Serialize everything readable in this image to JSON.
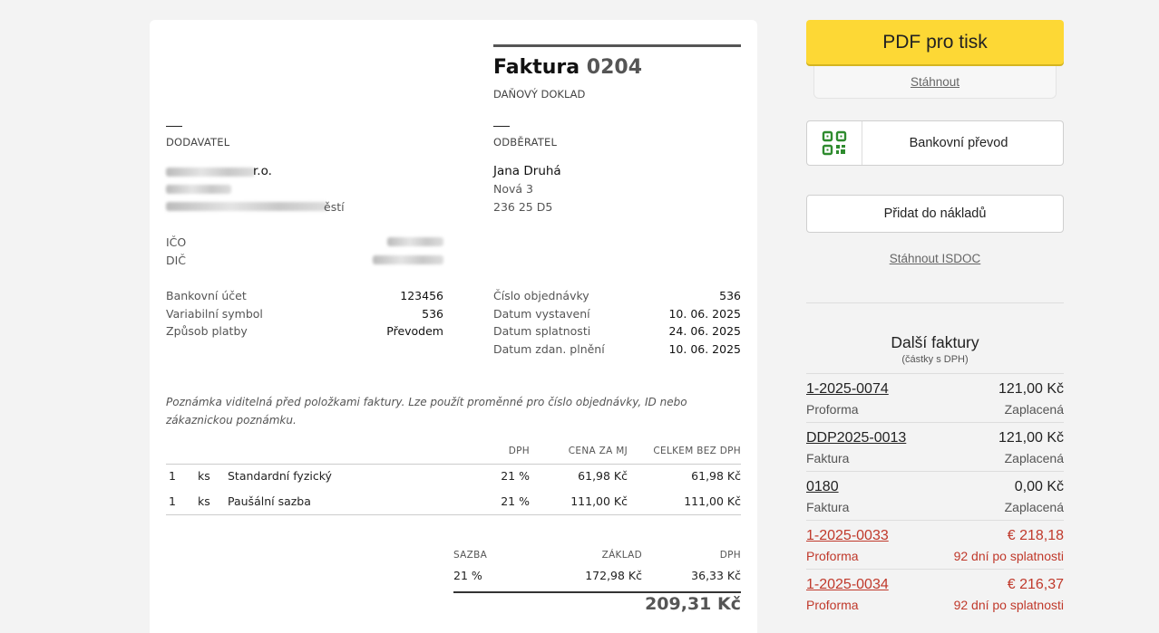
{
  "invoice": {
    "title_prefix": "Faktura",
    "number": "0204",
    "subtitle": "DAŇOVÝ DOKLAD",
    "supplier": {
      "label": "DODAVATEL",
      "name_visible": "r.o.",
      "city_visible": "ěstí",
      "ico_label": "IČO",
      "dic_label": "DIČ"
    },
    "customer": {
      "label": "ODBĚRATEL",
      "name": "Jana Druhá",
      "street": "Nová 3",
      "city": "236 25 D5"
    },
    "payment": {
      "bank_account_label": "Bankovní účet",
      "bank_account": "123456",
      "variable_symbol_label": "Variabilní symbol",
      "variable_symbol": "536",
      "method_label": "Způsob platby",
      "method": "Převodem"
    },
    "dates": {
      "order_no_label": "Číslo objednávky",
      "order_no": "536",
      "issued_label": "Datum vystavení",
      "issued": "10. 06. 2025",
      "due_label": "Datum splatnosti",
      "due": "24. 06. 2025",
      "taxable_label": "Datum zdan. plnění",
      "taxable": "10. 06. 2025"
    },
    "note": "Poznámka viditelná před položkami faktury. Lze použít proměnné pro číslo objednávky, ID nebo zákaznickou poznámku.",
    "items_header": {
      "vat": "DPH",
      "unit_price": "CENA ZA MJ",
      "total_ex_vat": "CELKEM BEZ DPH"
    },
    "items": [
      {
        "qty": "1",
        "unit": "ks",
        "name": "Standardní fyzický",
        "vat": "21 %",
        "unit_price": "61,98 Kč",
        "total": "61,98 Kč"
      },
      {
        "qty": "1",
        "unit": "ks",
        "name": "Paušální sazba",
        "vat": "21 %",
        "unit_price": "111,00 Kč",
        "total": "111,00 Kč"
      }
    ],
    "summary_header": {
      "rate": "SAZBA",
      "base": "ZÁKLAD",
      "vat": "DPH"
    },
    "summary_row": {
      "rate": "21 %",
      "base": "172,98 Kč",
      "vat": "36,33 Kč"
    },
    "grand_total": "209,31 Kč"
  },
  "sidebar": {
    "pdf_button": "PDF pro tisk",
    "download_link": "Stáhnout",
    "bank_transfer_button": "Bankovní převod",
    "add_costs_button": "Přidat do nákladů",
    "isdoc_link": "Stáhnout ISDOC",
    "other_invoices": {
      "title": "Další faktury",
      "subtitle": "(částky s DPH)",
      "items": [
        {
          "number": "1-2025-0074",
          "amount": "121,00 Kč",
          "type": "Proforma",
          "status": "Zaplacená"
        },
        {
          "number": "DDP2025-0013",
          "amount": "121,00 Kč",
          "type": "Faktura",
          "status": "Zaplacená"
        },
        {
          "number": "0180",
          "amount": "0,00 Kč",
          "type": "Faktura",
          "status": "Zaplacená"
        },
        {
          "number": "1-2025-0033",
          "amount": "€ 218,18",
          "type": "Proforma",
          "status": "92 dní po splatnosti"
        },
        {
          "number": "1-2025-0034",
          "amount": "€ 216,37",
          "type": "Proforma",
          "status": "92 dní po splatnosti"
        }
      ]
    },
    "colors": {
      "primary_button": "#fdd835",
      "overdue": "#c0392b"
    }
  }
}
